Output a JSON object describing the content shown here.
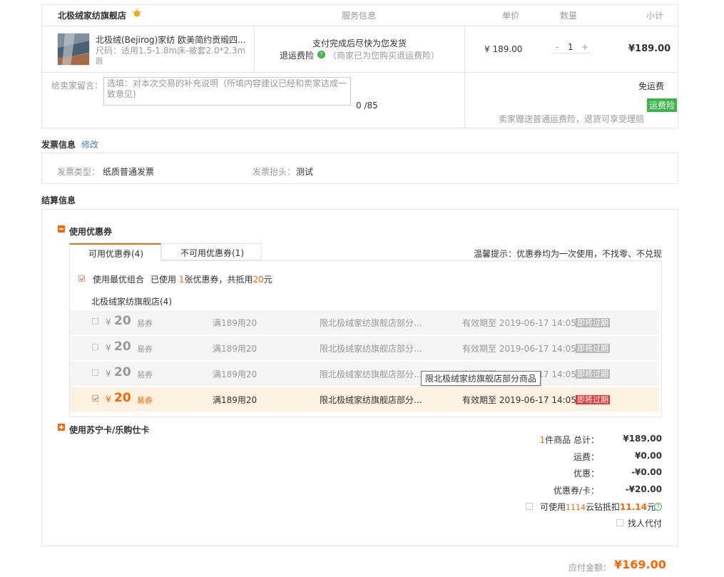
{
  "store": {
    "name": "北极绒家纺旗舰店",
    "col_service": "服务信息",
    "col_price": "单价",
    "col_qty": "数量",
    "col_subtotal": "小计"
  },
  "product": {
    "title": "北极绒(Bejirog)家纺 欧美简约贡缎四...",
    "spec": "尺码：适用1.5-1.8m床-被套2.0*2.3m ...",
    "badge": "圆",
    "service_line1": "支付完成后尽快为您发货",
    "insurance_label": "退运费险",
    "insurance_note": "（商家已为您购买退运费险）",
    "price": "¥ 189.00",
    "qty_minus": "-",
    "qty": "1",
    "qty_plus": "+",
    "subtotal": "¥189.00"
  },
  "message": {
    "label": "给卖家留言：",
    "placeholder": "选填：对本次交易的补充说明（所填内容建议已经和卖家达成一致意见)",
    "counter": "0 /85",
    "shipping": "免运费",
    "insurance_tag": "运费险",
    "insurance_desc": "卖家赠送普通运费险，退货可享受理赔"
  },
  "invoice": {
    "title": "发票信息",
    "edit": "修改",
    "type_label": "发票类型：",
    "type_value": "纸质普通发票",
    "head_label": "发票抬头：",
    "head_value": "测试"
  },
  "settlement": {
    "title": "结算信息",
    "coupon_toggle": "使用优惠券",
    "tab_available": "可用优惠券(4)",
    "tab_unavailable": "不可用优惠券(1)",
    "tip": "温馨提示：优惠券均为一次使用，不找零、不兑现",
    "best_combo": "使用最优组合",
    "used_prefix": "已使用",
    "used_count": "1",
    "used_mid": "张优惠券，共抵用",
    "used_amount": "20",
    "used_suffix": "元",
    "shop_group": "北极绒家纺旗舰店(4)",
    "coupons": [
      {
        "yen": "¥",
        "amount": "20",
        "kind": "易券",
        "condition": "满189用20",
        "scope": "限北极绒家纺旗舰店部分...",
        "expiry": "有效期至 2019-06-17 14:05",
        "tag": "即将过期"
      },
      {
        "yen": "¥",
        "amount": "20",
        "kind": "易券",
        "condition": "满189用20",
        "scope": "限北极绒家纺旗舰店部分...",
        "expiry": "有效期至 2019-06-17 14:05",
        "tag": "即将过期"
      },
      {
        "yen": "¥",
        "amount": "20",
        "kind": "易券",
        "condition": "满189用20",
        "scope": "限北极绒家纺旗舰店部分...",
        "expiry": "有效期至 2019-06-17 14:05",
        "tag": "即将过期"
      },
      {
        "yen": "¥",
        "amount": "20",
        "kind": "易券",
        "condition": "满189用20",
        "scope": "限北极绒家纺旗舰店部分...",
        "expiry": "有效期至 2019-06-17 14:05",
        "tag": "即将过期"
      }
    ],
    "tooltip": "限北极绒家纺旗舰店部分商品",
    "card_toggle": "使用苏宁卡/乐购仕卡"
  },
  "summary": {
    "count": "1",
    "count_label": "件商品 总计：",
    "total": "¥189.00",
    "shipping_label": "运费：",
    "shipping": "¥0.00",
    "discount_label": "优惠：",
    "discount": "-¥0.00",
    "coupon_label": "优惠券/卡：",
    "coupon": "-¥20.00",
    "diamond_prefix": "可使用",
    "diamond_count": "1114",
    "diamond_mid": "云钻抵扣",
    "diamond_amount": "11.14",
    "diamond_suffix": "元",
    "proxy_pay": "找人代付",
    "pay_label": "应付金额：",
    "pay_amount": "¥169.00"
  },
  "colors": {
    "accent": "#ff6600",
    "expiring_tag": "#e4393c",
    "green_tag": "#3bb54a",
    "link": "#3f7fc1"
  }
}
